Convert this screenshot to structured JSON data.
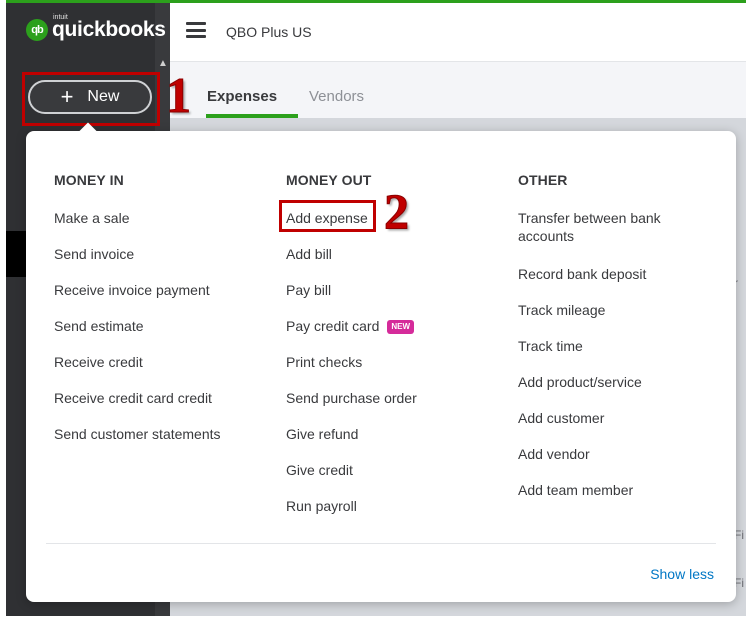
{
  "app": {
    "logo_small": "intuit",
    "logo_text": "quickbooks",
    "logo_mark": "qb",
    "company_name": "QBO Plus US"
  },
  "sidebar": {
    "new_button_label": "New",
    "new_button_icon": "plus-icon"
  },
  "tabs": [
    {
      "label": "Expenses",
      "active": true
    },
    {
      "label": "Vendors",
      "active": false
    }
  ],
  "annotations": {
    "step1": "1",
    "step2": "2",
    "color": "#c00000"
  },
  "menu": {
    "money_in": {
      "heading": "MONEY IN",
      "items": [
        "Make a sale",
        "Send invoice",
        "Receive invoice payment",
        "Send estimate",
        "Receive credit",
        "Receive credit card credit",
        "Send customer statements"
      ]
    },
    "money_out": {
      "heading": "MONEY OUT",
      "items": [
        "Add expense",
        "Add bill",
        "Pay bill",
        "Pay credit card",
        "Print checks",
        "Send purchase order",
        "Give refund",
        "Give credit",
        "Run payroll"
      ],
      "new_badge": "NEW"
    },
    "other": {
      "heading": "OTHER",
      "items": [
        "Transfer between bank accounts",
        "Record bank deposit",
        "Track mileage",
        "Track time",
        "Add product/service",
        "Add customer",
        "Add vendor",
        "Add team member"
      ]
    },
    "show_less": "Show less"
  },
  "colors": {
    "brand_green": "#2ca01c",
    "sidebar": "#393a3d",
    "link_blue": "#0077c5",
    "new_badge": "#d52b9a"
  }
}
